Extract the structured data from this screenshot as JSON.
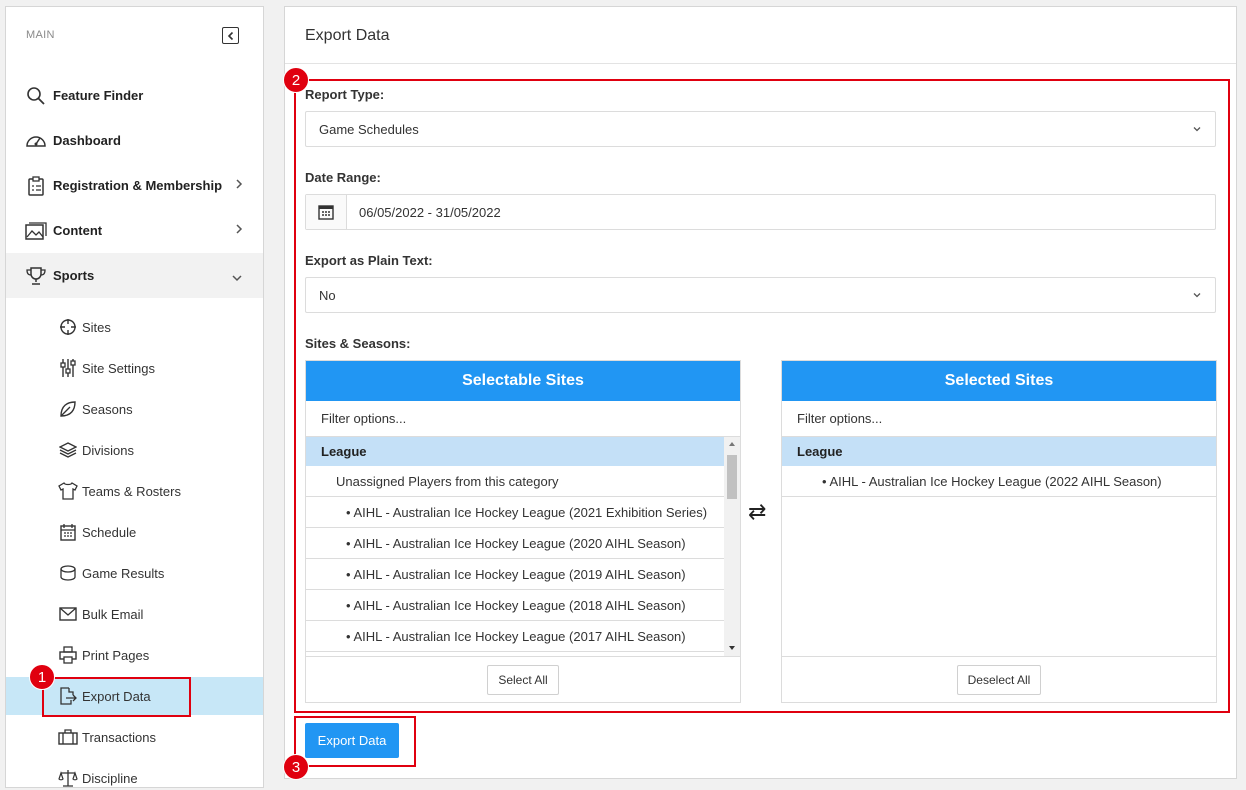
{
  "sidebar": {
    "section_label": "MAIN",
    "items": [
      {
        "label": "Feature Finder",
        "icon": "search-icon"
      },
      {
        "label": "Dashboard",
        "icon": "gauge-icon"
      },
      {
        "label": "Registration & Membership",
        "icon": "clipboard-icon"
      },
      {
        "label": "Content",
        "icon": "image-icon"
      },
      {
        "label": "Sports",
        "icon": "trophy-icon"
      }
    ],
    "sub_items": [
      {
        "label": "Sites",
        "icon": "crosshair-icon"
      },
      {
        "label": "Site Settings",
        "icon": "sliders-icon"
      },
      {
        "label": "Seasons",
        "icon": "leaf-icon"
      },
      {
        "label": "Divisions",
        "icon": "layers-icon"
      },
      {
        "label": "Teams & Rosters",
        "icon": "shirt-icon"
      },
      {
        "label": "Schedule",
        "icon": "calendar-icon"
      },
      {
        "label": "Game Results",
        "icon": "database-icon"
      },
      {
        "label": "Bulk Email",
        "icon": "envelope-icon"
      },
      {
        "label": "Print Pages",
        "icon": "printer-icon"
      },
      {
        "label": "Export Data",
        "icon": "file-export-icon"
      },
      {
        "label": "Transactions",
        "icon": "briefcase-icon"
      },
      {
        "label": "Discipline",
        "icon": "scales-icon"
      }
    ]
  },
  "page": {
    "title": "Export Data",
    "report_type_label": "Report Type:",
    "report_type_value": "Game Schedules",
    "date_range_label": "Date Range:",
    "date_range_value": "06/05/2022 - 31/05/2022",
    "plain_text_label": "Export as Plain Text:",
    "plain_text_value": "No",
    "sites_label": "Sites & Seasons:",
    "swap_symbol": "⇄",
    "export_button": "Export Data"
  },
  "selectable": {
    "title": "Selectable Sites",
    "filter_placeholder": "Filter options...",
    "group": "League",
    "unassigned": "Unassigned Players from this category",
    "options": [
      "• AIHL - Australian Ice Hockey League (2021 Exhibition Series)",
      "• AIHL - Australian Ice Hockey League (2020 AIHL Season)",
      "• AIHL - Australian Ice Hockey League (2019 AIHL Season)",
      "• AIHL - Australian Ice Hockey League (2018 AIHL Season)",
      "• AIHL - Australian Ice Hockey League (2017 AIHL Season)"
    ],
    "button": "Select All"
  },
  "selected": {
    "title": "Selected Sites",
    "filter_placeholder": "Filter options...",
    "group": "League",
    "options": [
      "• AIHL - Australian Ice Hockey League (2022 AIHL Season)"
    ],
    "button": "Deselect All"
  },
  "annotations": [
    "1",
    "2",
    "3"
  ],
  "colors": {
    "accent": "#2196f3",
    "annotation": "#e0000f",
    "active_bg": "#c7e7f7",
    "group_bg": "#c4e0f7"
  }
}
